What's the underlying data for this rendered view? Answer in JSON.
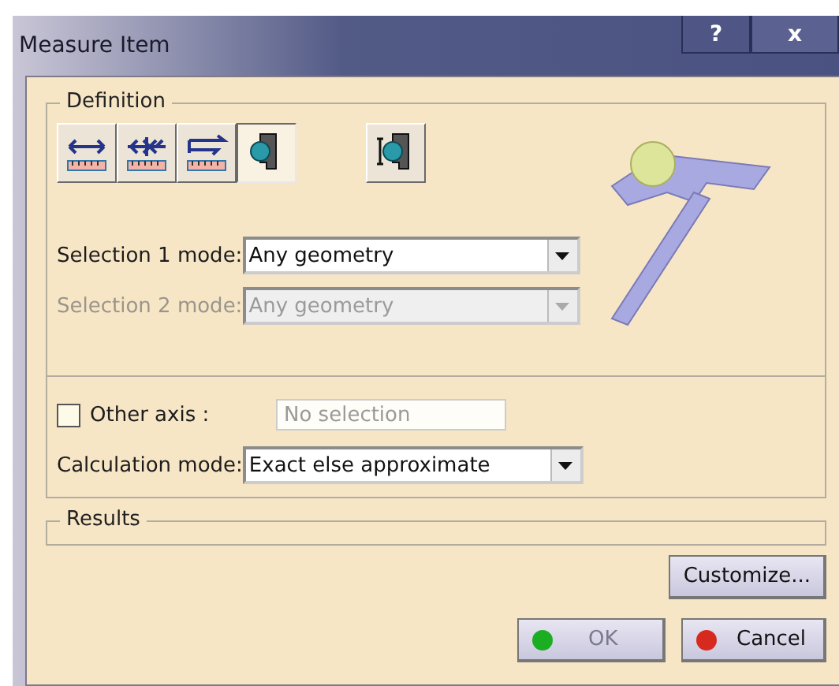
{
  "window": {
    "title": "Measure Item",
    "help_button": "?",
    "close_button": "x"
  },
  "definition": {
    "label": "Definition",
    "mode_buttons": [
      {
        "kind": "between",
        "selected": false
      },
      {
        "kind": "chain",
        "selected": false
      },
      {
        "kind": "fan",
        "selected": false
      },
      {
        "kind": "item",
        "selected": true
      },
      {
        "kind": "thickness",
        "selected": false
      }
    ],
    "selections": [
      {
        "label": "Selection 1 mode:",
        "value": "Any geometry",
        "disabled": false
      },
      {
        "label": "Selection 2 mode:",
        "value": "Any geometry",
        "disabled": true
      }
    ]
  },
  "other_axis": {
    "label": "Other axis :",
    "checked": false,
    "placeholder": "No selection"
  },
  "calculation": {
    "label": "Calculation mode:",
    "value": "Exact else approximate"
  },
  "results": {
    "label": "Results"
  },
  "customize_button": "Customize...",
  "buttons": [
    {
      "label": "OK",
      "kind": "ok",
      "disabled": true
    },
    {
      "label": "Cancel",
      "kind": "cancel",
      "disabled": false
    }
  ]
}
